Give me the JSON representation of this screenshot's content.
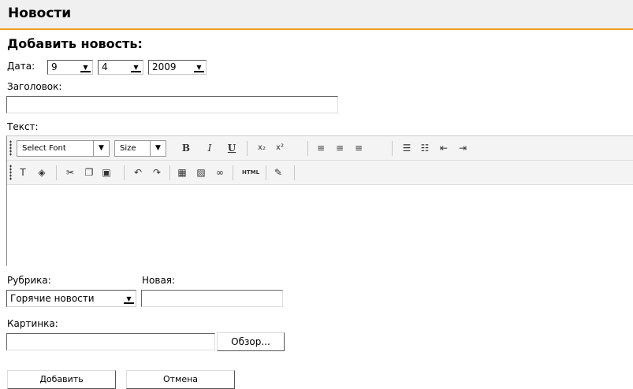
{
  "header": {
    "title": "Новости"
  },
  "form": {
    "heading": "Добавить новость:",
    "date_label": "Дата:",
    "day": "9",
    "month": "4",
    "year": "2009",
    "title_label": "Заголовок:",
    "title_value": "",
    "text_label": "Текст:",
    "category_label": "Рубрика:",
    "category_value": "Горячие новости",
    "new_label": "Новая:",
    "new_value": "",
    "image_label": "Картинка:",
    "browse_label": "Обзор...",
    "submit_label": "Добавить",
    "cancel_label": "Отмена"
  },
  "editor": {
    "font_select": "Select Font",
    "size_select": "Size",
    "bold": "B",
    "italic": "I",
    "underline": "U",
    "html_button": "HTML",
    "body_text": ""
  }
}
